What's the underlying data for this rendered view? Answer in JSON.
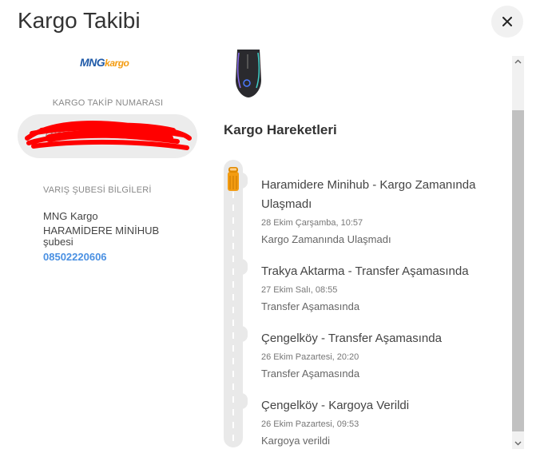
{
  "modal": {
    "title": "Kargo Takibi",
    "close_label": "×"
  },
  "carrier": {
    "logo_primary": "MNG",
    "logo_secondary": "kargo"
  },
  "tracking": {
    "label": "KARGO TAKİP NUMARASI",
    "number": "76••••••••••26"
  },
  "branch": {
    "label": "VARIŞ ŞUBESİ BİLGİLERİ",
    "company": "MNG Kargo",
    "name": "HARAMİDERE MİNİHUB",
    "suffix": "şubesi",
    "phone": "08502220606"
  },
  "movements": {
    "title": "Kargo Hareketleri",
    "events": [
      {
        "title": "Haramidere Minihub - Kargo Zamanında Ulaşmadı",
        "date": "28 Ekim Çarşamba, 10:57",
        "desc": "Kargo Zamanında Ulaşmadı"
      },
      {
        "title": "Trakya Aktarma - Transfer Aşamasında",
        "date": "27 Ekim Salı, 08:55",
        "desc": "Transfer Aşamasında"
      },
      {
        "title": "Çengelköy - Transfer Aşamasında",
        "date": "26 Ekim Pazartesi, 20:20",
        "desc": "Transfer Aşamasında"
      },
      {
        "title": "Çengelköy - Kargoya Verildi",
        "date": "26 Ekim Pazartesi, 09:53",
        "desc": "Kargoya verildi"
      }
    ]
  },
  "icons": {
    "close": "close-icon",
    "truck": "truck-icon",
    "product": "product-image-mouse"
  },
  "colors": {
    "accent": "#4a90e2",
    "truck": "#f39c12",
    "redaction": "#ff0000"
  }
}
